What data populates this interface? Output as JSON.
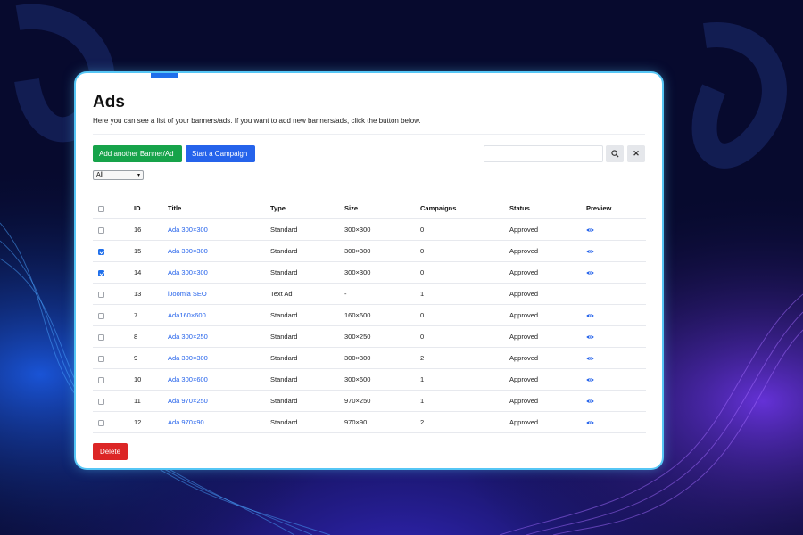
{
  "page": {
    "title": "Ads",
    "description": "Here you can see a list of your banners/ads. If you want to add new banners/ads, click the button below."
  },
  "actions": {
    "add_label": "Add another Banner/Ad",
    "campaign_label": "Start a Campaign",
    "delete_label": "Delete"
  },
  "search": {
    "value": "",
    "placeholder": "",
    "search_icon": "search-icon",
    "clear_icon": "close-icon",
    "clear_glyph": "✕"
  },
  "filter": {
    "selected": "All"
  },
  "table": {
    "headers": {
      "id": "ID",
      "title": "Title",
      "type": "Type",
      "size": "Size",
      "campaigns": "Campaigns",
      "status": "Status",
      "preview": "Preview"
    },
    "rows": [
      {
        "checked": false,
        "id": "16",
        "title": "Ada 300×300",
        "type": "Standard",
        "size": "300×300",
        "campaigns": "0",
        "status": "Approved",
        "preview": true
      },
      {
        "checked": true,
        "id": "15",
        "title": "Ada 300×300",
        "type": "Standard",
        "size": "300×300",
        "campaigns": "0",
        "status": "Approved",
        "preview": true
      },
      {
        "checked": true,
        "id": "14",
        "title": "Ada 300×300",
        "type": "Standard",
        "size": "300×300",
        "campaigns": "0",
        "status": "Approved",
        "preview": true
      },
      {
        "checked": false,
        "id": "13",
        "title": "iJoomla SEO",
        "type": "Text Ad",
        "size": "-",
        "campaigns": "1",
        "status": "Approved",
        "preview": false
      },
      {
        "checked": false,
        "id": "7",
        "title": "Ada160×600",
        "type": "Standard",
        "size": "160×600",
        "campaigns": "0",
        "status": "Approved",
        "preview": true
      },
      {
        "checked": false,
        "id": "8",
        "title": "Ada 300×250",
        "type": "Standard",
        "size": "300×250",
        "campaigns": "0",
        "status": "Approved",
        "preview": true
      },
      {
        "checked": false,
        "id": "9",
        "title": "Ada 300×300",
        "type": "Standard",
        "size": "300×300",
        "campaigns": "2",
        "status": "Approved",
        "preview": true
      },
      {
        "checked": false,
        "id": "10",
        "title": "Ada 300×600",
        "type": "Standard",
        "size": "300×600",
        "campaigns": "1",
        "status": "Approved",
        "preview": true
      },
      {
        "checked": false,
        "id": "11",
        "title": "Ada 970×250",
        "type": "Standard",
        "size": "970×250",
        "campaigns": "1",
        "status": "Approved",
        "preview": true
      },
      {
        "checked": false,
        "id": "12",
        "title": "Ada 970×90",
        "type": "Standard",
        "size": "970×90",
        "campaigns": "2",
        "status": "Approved",
        "preview": true
      }
    ]
  },
  "colors": {
    "accent": "#2563eb",
    "add_button": "#16a34a",
    "delete_button": "#dc2626",
    "panel_glow": "#56c6f5",
    "background": "#070a2e"
  }
}
